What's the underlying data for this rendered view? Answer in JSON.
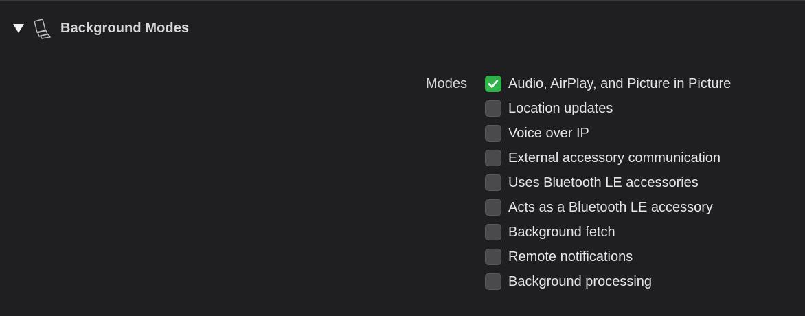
{
  "section": {
    "title": "Background Modes",
    "disclosure_icon": "triangle-down-icon",
    "capability_icon": "layered-pages-icon",
    "expanded": true
  },
  "modes": {
    "label": "Modes",
    "items": [
      {
        "label": "Audio, AirPlay, and Picture in Picture",
        "checked": true
      },
      {
        "label": "Location updates",
        "checked": false
      },
      {
        "label": "Voice over IP",
        "checked": false
      },
      {
        "label": "External accessory communication",
        "checked": false
      },
      {
        "label": "Uses Bluetooth LE accessories",
        "checked": false
      },
      {
        "label": "Acts as a Bluetooth LE accessory",
        "checked": false
      },
      {
        "label": "Background fetch",
        "checked": false
      },
      {
        "label": "Remote notifications",
        "checked": false
      },
      {
        "label": "Background processing",
        "checked": false
      }
    ]
  },
  "colors": {
    "background": "#1f1f21",
    "checked_accent": "#31b14a",
    "unchecked_box": "#4a4a4c"
  }
}
